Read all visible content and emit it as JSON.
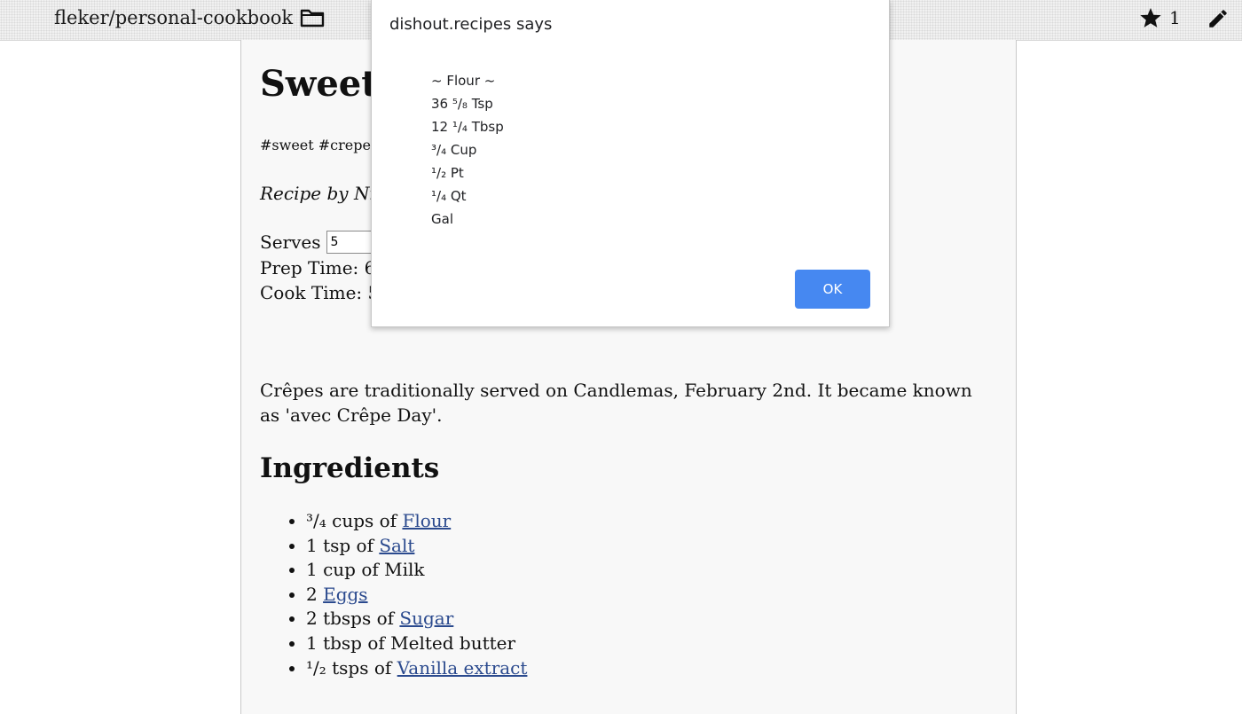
{
  "header": {
    "repo_name": "fleker/personal-cookbook",
    "star_count": "1"
  },
  "recipe": {
    "title": "Sweet",
    "tags": "#sweet #crepe",
    "author": "Recipe by Ni",
    "serves_label": "Serves",
    "serves_value": "5",
    "prep_time": "Prep Time: 6",
    "cook_time": "Cook Time: 5",
    "description": "Crêpes are traditionally served on Candlemas, February 2nd. It became known as 'avec Crêpe Day'.",
    "ingredients_heading": "Ingredients",
    "ingredients": [
      {
        "prefix": "³/₄ cups of ",
        "link": "Flour",
        "text": ""
      },
      {
        "prefix": "1 tsp of ",
        "link": "Salt",
        "text": ""
      },
      {
        "prefix": "1 cup of Milk",
        "link": "",
        "text": ""
      },
      {
        "prefix": "2 ",
        "link": "Eggs",
        "text": ""
      },
      {
        "prefix": "2 tbsps of ",
        "link": "Sugar",
        "text": ""
      },
      {
        "prefix": "1 tbsp of Melted butter",
        "link": "",
        "text": ""
      },
      {
        "prefix": "¹/₂ tsps of ",
        "link": "Vanilla extract",
        "text": ""
      }
    ]
  },
  "dialog": {
    "title": "dishout.recipes says",
    "lines": [
      "~ Flour ~",
      "36 ⁵/₈ Tsp",
      "12 ¹/₄ Tbsp",
      "³/₄ Cup",
      "¹/₂ Pt",
      "¹/₄ Qt",
      " Gal"
    ],
    "ok_label": "OK",
    "ok_color": "#4688f1"
  },
  "icons": {
    "folder": "folder-icon",
    "star": "star-icon",
    "edit": "pencil-icon"
  }
}
